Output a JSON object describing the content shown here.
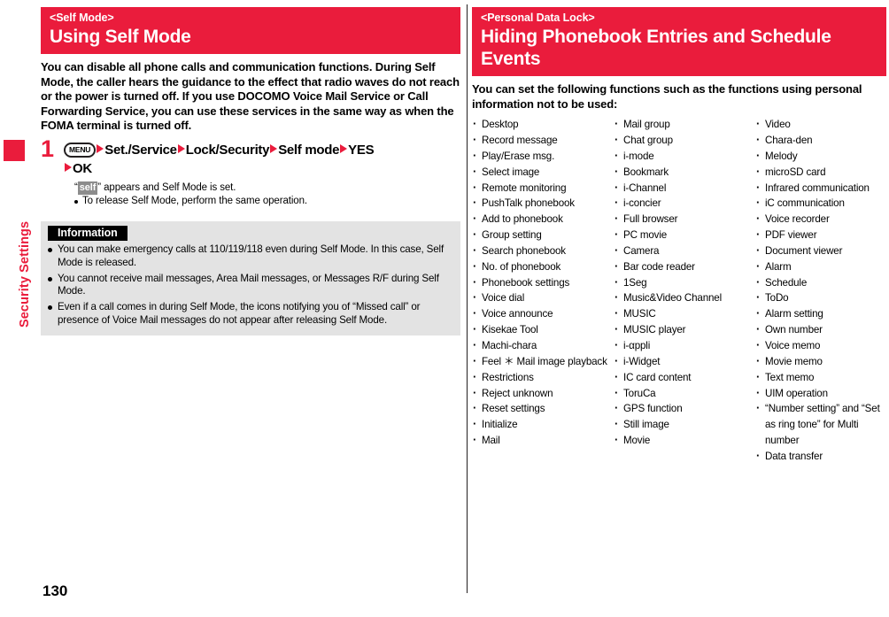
{
  "sidebar": {
    "chapter_label": "Security Settings",
    "tab_color": "#ea1c3c"
  },
  "page_number": "130",
  "left_panel": {
    "section": {
      "kicker": "<Self Mode>",
      "title": "Using Self Mode"
    },
    "lead": "You can disable all phone calls and communication functions. During Self Mode, the caller hears the guidance to the effect that radio waves do not reach or the power is turned off. If you use DOCOMO Voice Mail Service or Call Forwarding Service, you can use these services in the same way as when the FOMA terminal is turned off.",
    "step": {
      "number": "1",
      "key_label": "MENU",
      "path": [
        "Set./Service",
        "Lock/Security",
        "Self mode",
        "YES",
        "OK"
      ],
      "note_prefix": "“",
      "note_chip": "self",
      "note_suffix": "” appears and Self Mode is set.",
      "note_bullet": "To release Self Mode, perform the same operation."
    },
    "information": {
      "heading": "Information",
      "items": [
        "You can make emergency calls at 110/119/118 even during Self Mode. In this case, Self Mode is released.",
        "You cannot receive mail messages, Area Mail messages, or Messages R/F during Self Mode.",
        "Even if a call comes in during Self Mode, the icons notifying you of “Missed call” or presence of Voice Mail messages do not appear after releasing Self Mode."
      ]
    }
  },
  "right_panel": {
    "section": {
      "kicker": "<Personal Data Lock>",
      "title": "Hiding Phonebook Entries and Schedule Events"
    },
    "lead": "You can set the following functions such as the functions using personal information not to be used:",
    "function_columns": [
      [
        "Desktop",
        "Record message",
        "Play/Erase msg.",
        "Select image",
        "Remote monitoring",
        "PushTalk phonebook",
        "Add to phonebook",
        "Group setting",
        "Search phonebook",
        "No. of phonebook",
        "Phonebook settings",
        "Voice dial",
        "Voice announce",
        "Kisekae Tool",
        "Machi-chara",
        "Feel ＊ Mail image playback",
        "Restrictions",
        "Reject unknown",
        "Reset settings",
        "Initialize",
        "Mail"
      ],
      [
        "Mail group",
        "Chat group",
        "i-mode",
        "Bookmark",
        "i-Channel",
        "i-concier",
        "Full browser",
        "PC movie",
        "Camera",
        "Bar code reader",
        "1Seg",
        "Music&Video Channel",
        "MUSIC",
        "MUSIC player",
        "i-αppli",
        "i-Widget",
        "IC card content",
        "ToruCa",
        "GPS function",
        "Still image",
        "Movie"
      ],
      [
        "Video",
        "Chara-den",
        "Melody",
        "microSD card",
        "Infrared communication",
        "iC communication",
        "Voice recorder",
        "PDF viewer",
        "Document viewer",
        "Alarm",
        "Schedule",
        "ToDo",
        "Alarm setting",
        "Own number",
        "Voice memo",
        "Movie memo",
        "Text memo",
        "UIM operation",
        "“Number setting” and “Set as ring tone” for Multi number",
        "Data transfer"
      ]
    ]
  }
}
